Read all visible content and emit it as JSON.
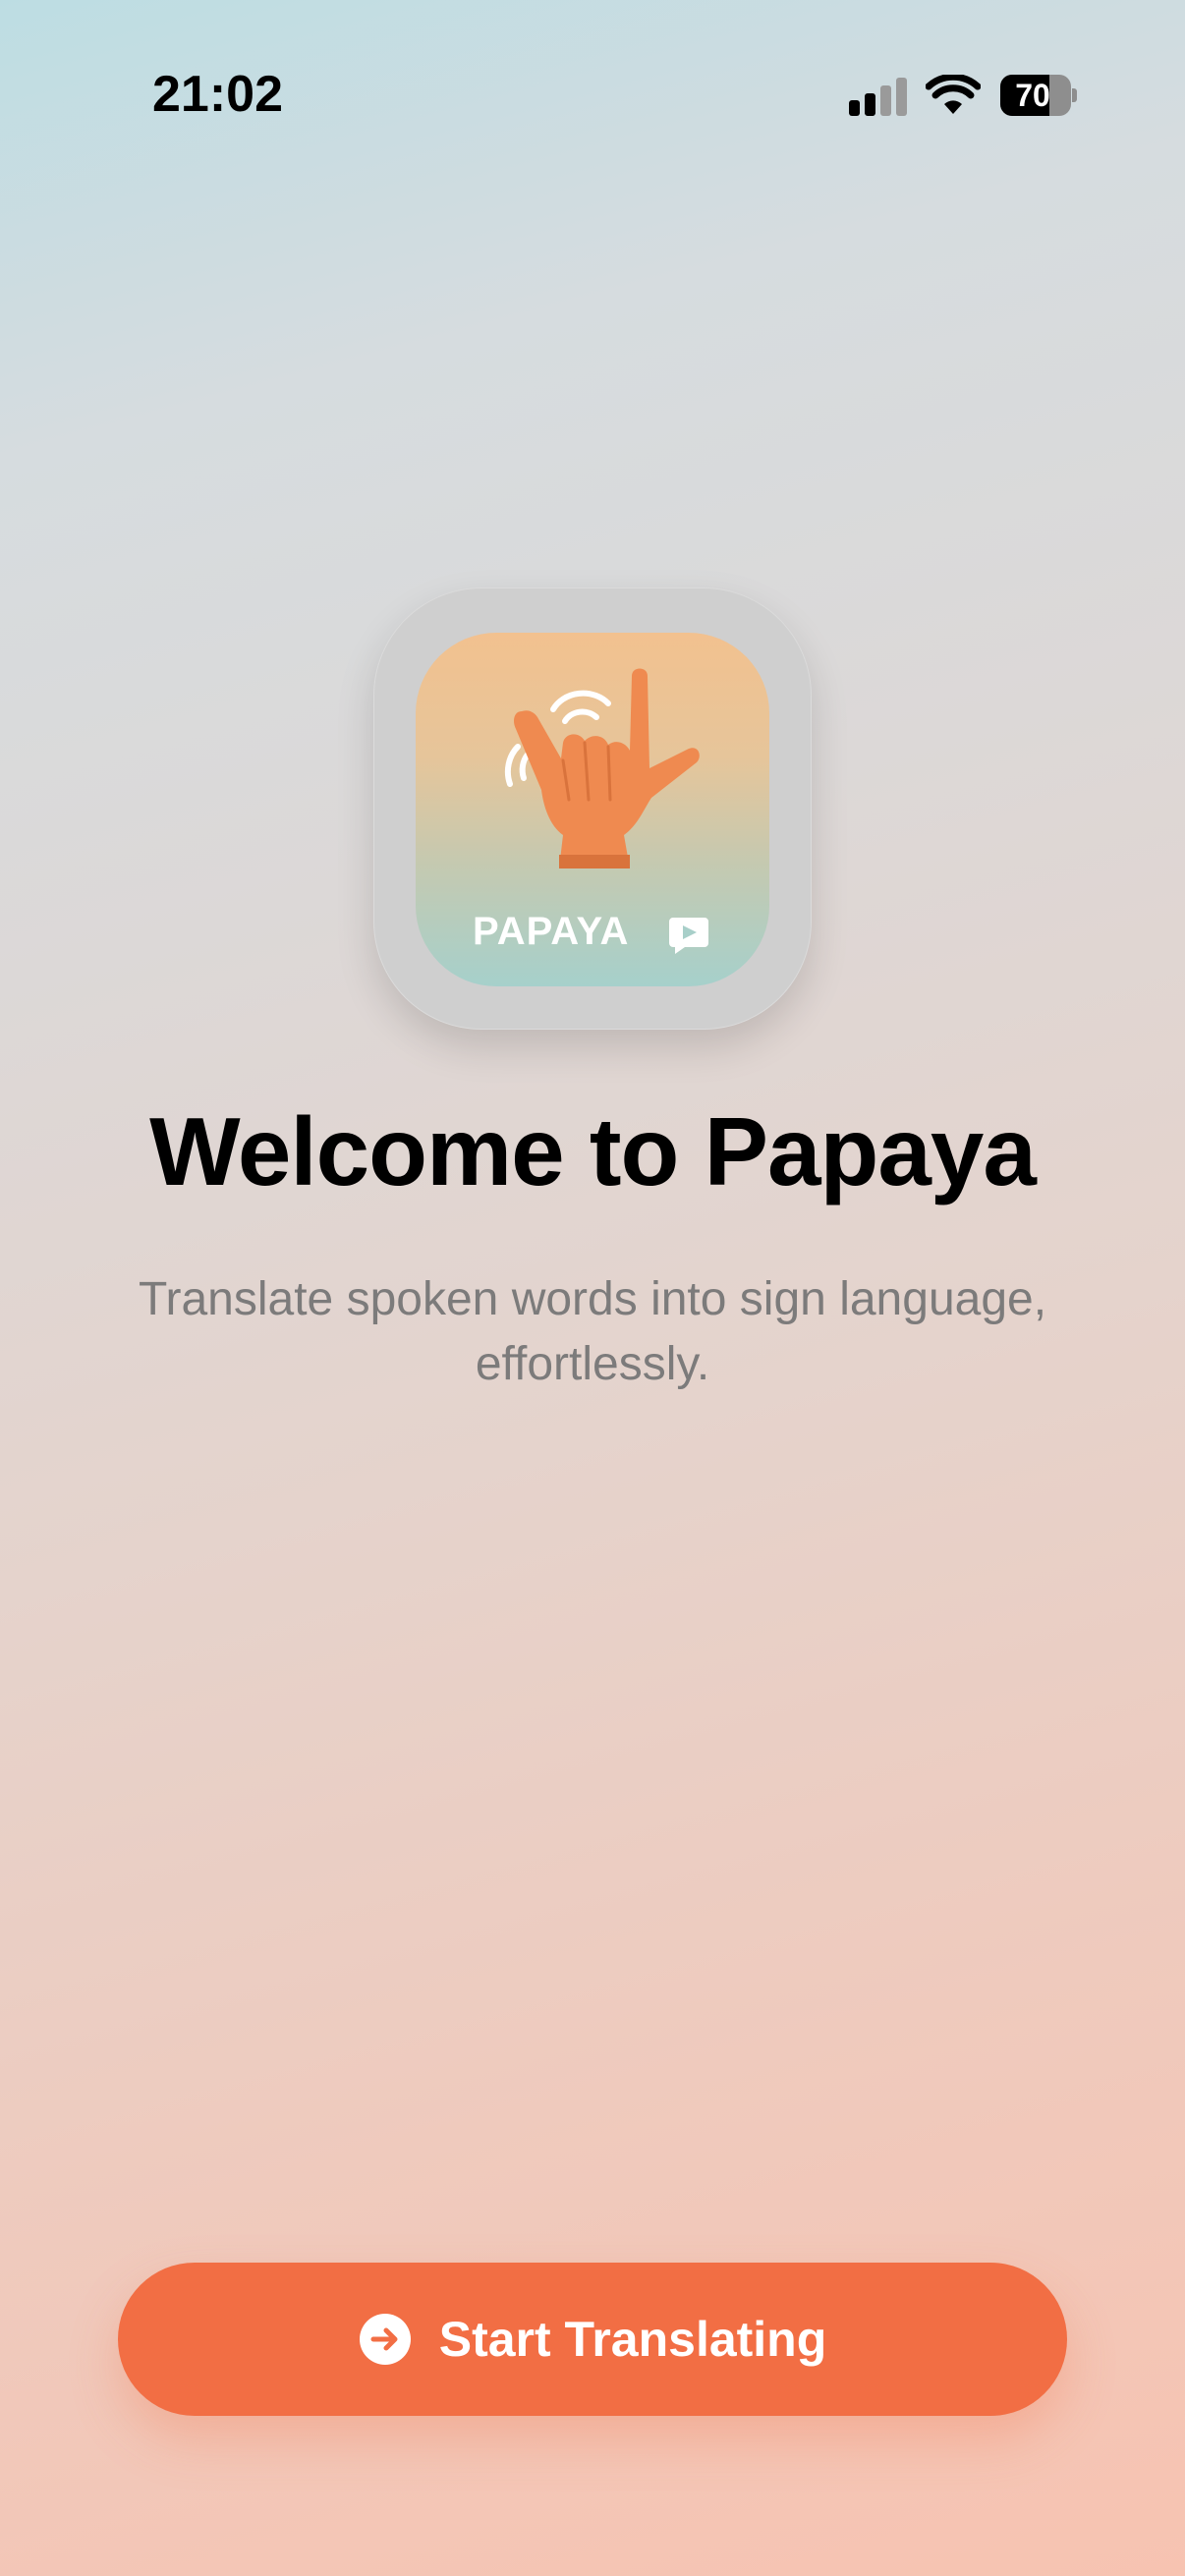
{
  "status_bar": {
    "time": "21:02",
    "battery_level": "70",
    "signal_bars_active": 2,
    "signal_bars_total": 4
  },
  "app_icon": {
    "brand_label": "PAPAYA",
    "icon_name": "sign-language-hand-icon"
  },
  "welcome": {
    "title": "Welcome to Papaya",
    "subtitle": "Translate spoken words into sign language, effortlessly."
  },
  "start_button": {
    "label": "Start Translating",
    "icon": "arrow-circle-right-icon"
  },
  "colors": {
    "accent": "#f26e44",
    "hand": "#ef8a50",
    "title_text": "#000000",
    "subtitle_text": "#7c7b7b"
  }
}
